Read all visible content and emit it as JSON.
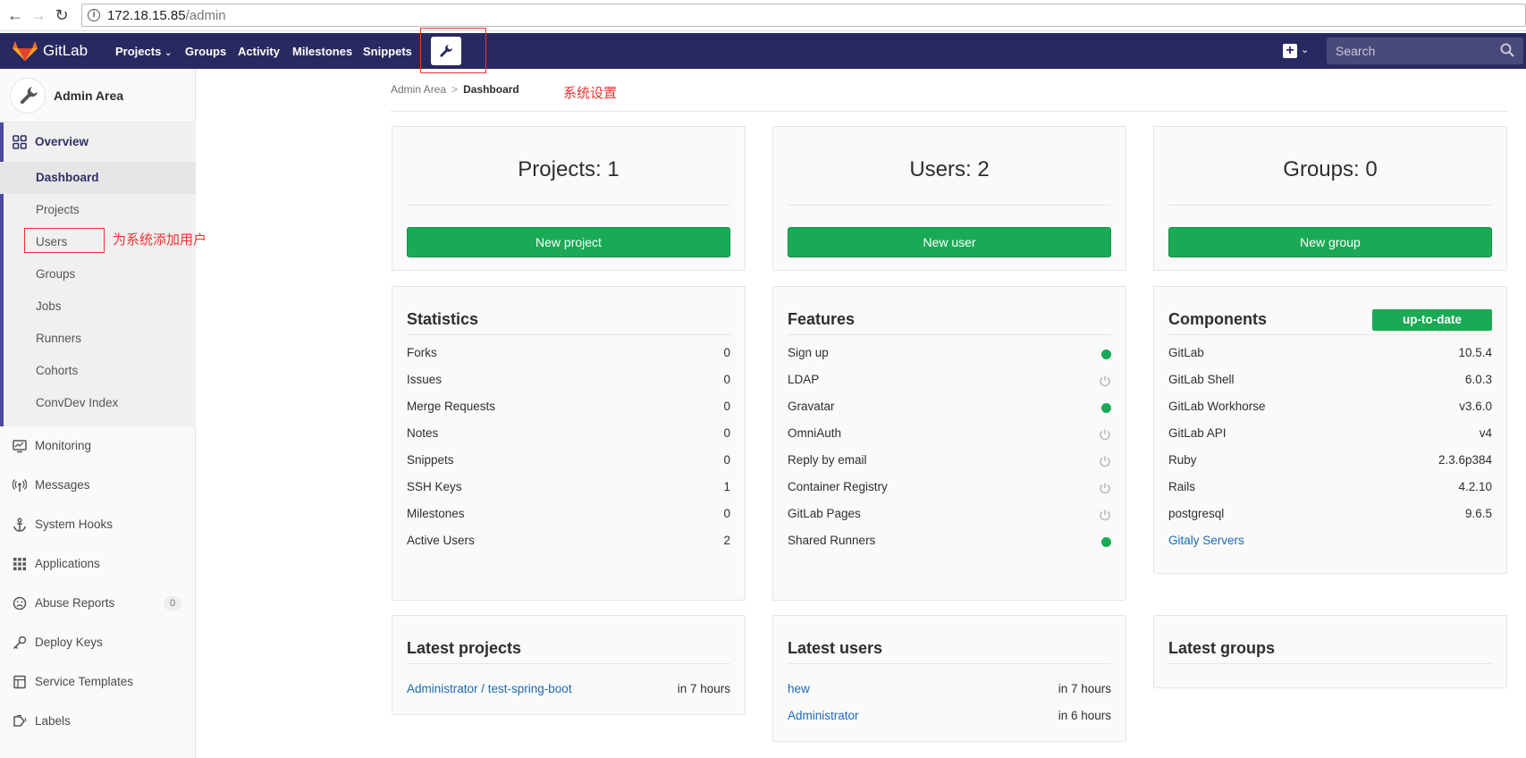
{
  "browser": {
    "url_host": "172.18.15.85",
    "url_path": "/admin",
    "back_icon": "arrow-left-icon",
    "forward_icon": "arrow-right-icon",
    "reload_icon": "reload-icon"
  },
  "topnav": {
    "brand": "GitLab",
    "links": [
      "Projects",
      "Groups",
      "Activity",
      "Milestones",
      "Snippets"
    ],
    "projects_caret": "⌵",
    "search_placeholder": "Search",
    "bg_color": "#292961"
  },
  "sidebar": {
    "title": "Admin Area",
    "overview": "Overview",
    "overview_items": [
      "Dashboard",
      "Projects",
      "Users",
      "Groups",
      "Jobs",
      "Runners",
      "Cohorts",
      "ConvDev Index"
    ],
    "items": [
      "Monitoring",
      "Messages",
      "System Hooks",
      "Applications",
      "Abuse Reports",
      "Deploy Keys",
      "Service Templates",
      "Labels"
    ],
    "abuse_badge": "0"
  },
  "annotations": {
    "settings": "系统设置",
    "add_users": "为系统添加用户"
  },
  "breadcrumb": {
    "root": "Admin Area",
    "current": "Dashboard"
  },
  "counts": {
    "projects_title": "Projects: 1",
    "projects_button": "New project",
    "users_title": "Users: 2",
    "users_button": "New user",
    "groups_title": "Groups: 0",
    "groups_button": "New group"
  },
  "statistics": {
    "title": "Statistics",
    "rows": [
      {
        "label": "Forks",
        "value": "0"
      },
      {
        "label": "Issues",
        "value": "0"
      },
      {
        "label": "Merge Requests",
        "value": "0"
      },
      {
        "label": "Notes",
        "value": "0"
      },
      {
        "label": "Snippets",
        "value": "0"
      },
      {
        "label": "SSH Keys",
        "value": "1"
      },
      {
        "label": "Milestones",
        "value": "0"
      },
      {
        "label": "Active Users",
        "value": "2"
      }
    ]
  },
  "features": {
    "title": "Features",
    "rows": [
      {
        "label": "Sign up",
        "enabled": true
      },
      {
        "label": "LDAP",
        "enabled": false
      },
      {
        "label": "Gravatar",
        "enabled": true
      },
      {
        "label": "OmniAuth",
        "enabled": false
      },
      {
        "label": "Reply by email",
        "enabled": false
      },
      {
        "label": "Container Registry",
        "enabled": false
      },
      {
        "label": "GitLab Pages",
        "enabled": false
      },
      {
        "label": "Shared Runners",
        "enabled": true
      }
    ]
  },
  "components": {
    "title": "Components",
    "status": "up-to-date",
    "rows": [
      {
        "label": "GitLab",
        "value": "10.5.4"
      },
      {
        "label": "GitLab Shell",
        "value": "6.0.3"
      },
      {
        "label": "GitLab Workhorse",
        "value": "v3.6.0"
      },
      {
        "label": "GitLab API",
        "value": "v4"
      },
      {
        "label": "Ruby",
        "value": "2.3.6p384"
      },
      {
        "label": "Rails",
        "value": "4.2.10"
      },
      {
        "label": "postgresql",
        "value": "9.6.5"
      }
    ],
    "gitaly_link": "Gitaly Servers"
  },
  "latest_projects": {
    "title": "Latest projects",
    "rows": [
      {
        "name": "Administrator / test-spring-boot",
        "time": "in 7 hours"
      }
    ]
  },
  "latest_users": {
    "title": "Latest users",
    "rows": [
      {
        "name": "hew",
        "time": "in 7 hours"
      },
      {
        "name": "Administrator",
        "time": "in 6 hours"
      }
    ]
  },
  "latest_groups": {
    "title": "Latest groups"
  }
}
